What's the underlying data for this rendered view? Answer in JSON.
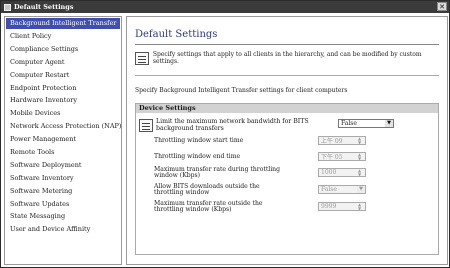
{
  "window": {
    "title": "Default Settings",
    "close_glyph": "✕"
  },
  "sidebar": {
    "items": [
      {
        "label": "Background Intelligent Transfer",
        "selected": true
      },
      {
        "label": "Client Policy"
      },
      {
        "label": "Compliance Settings"
      },
      {
        "label": "Computer Agent"
      },
      {
        "label": "Computer Restart"
      },
      {
        "label": "Endpoint Protection"
      },
      {
        "label": "Hardware Inventory"
      },
      {
        "label": "Mobile Devices"
      },
      {
        "label": "Network Access Protection (NAP)"
      },
      {
        "label": "Power Management"
      },
      {
        "label": "Remote Tools"
      },
      {
        "label": "Software Deployment"
      },
      {
        "label": "Software Inventory"
      },
      {
        "label": "Software Metering"
      },
      {
        "label": "Software Updates"
      },
      {
        "label": "State Messaging"
      },
      {
        "label": "User and Device Affinity"
      }
    ]
  },
  "main": {
    "title": "Default Settings",
    "info_text": "Specify settings that apply to all clients in the hierarchy, and can be modified by custom settings.",
    "specify_text": "Specify Background Intelligent Transfer settings for client computers",
    "group_title": "Device Settings",
    "limit": {
      "label": "Limit the maximum network bandwidth for BITS background transfers",
      "value": "False"
    },
    "rows": [
      {
        "label": "Throttling window start time",
        "value": "上午 09"
      },
      {
        "label": "Throttling window end time",
        "value": "下午 05"
      },
      {
        "label": "Maximum transfer rate during throttling window (Kbps)",
        "value": "1000"
      },
      {
        "label": "Allow BITS downloads outside the throttling window",
        "value": "False"
      },
      {
        "label": "Maximum transfer rate outside the throttling window (Kbps)",
        "value": "9999"
      }
    ]
  },
  "colors": {
    "title_bar": "#3b3b3b",
    "selected": "#3e4fb0",
    "page_title": "#2c3a7a",
    "group_header": "#d2d2d2"
  }
}
